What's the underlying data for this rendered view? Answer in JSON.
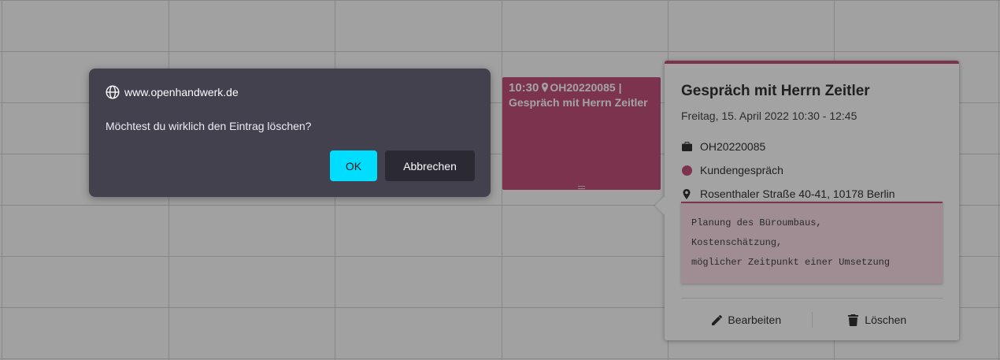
{
  "calendar": {
    "event": {
      "time": "10:30",
      "order_number": "OH20220085",
      "separator": "|",
      "title": "Gespräch mit Herrn Zeitler",
      "color": "#c2507a"
    }
  },
  "popover": {
    "title": "Gespräch mit Herrn Zeitler",
    "date": "Freitag, 15. April 2022 10:30 - 12:45",
    "order_number": "OH20220085",
    "category": "Kundengespräch",
    "category_color": "#c2507a",
    "address": "Rosenthaler Straße 40-41, 10178 Berlin",
    "notes": [
      "Planung des Büroumbaus,",
      "Kostenschätzung,",
      "möglicher Zeitpunkt einer Umsetzung"
    ],
    "edit_label": "Bearbeiten",
    "delete_label": "Löschen",
    "icons": {
      "order": "briefcase-icon",
      "address": "map-marker-icon",
      "edit": "pencil-icon",
      "delete": "trash-icon"
    }
  },
  "dialog": {
    "origin": "www.openhandwerk.de",
    "message": "Möchtest du wirklich den Eintrag löschen?",
    "ok_label": "OK",
    "cancel_label": "Abbrechen",
    "ok_color": "#00ddff",
    "origin_icon": "globe-icon"
  }
}
